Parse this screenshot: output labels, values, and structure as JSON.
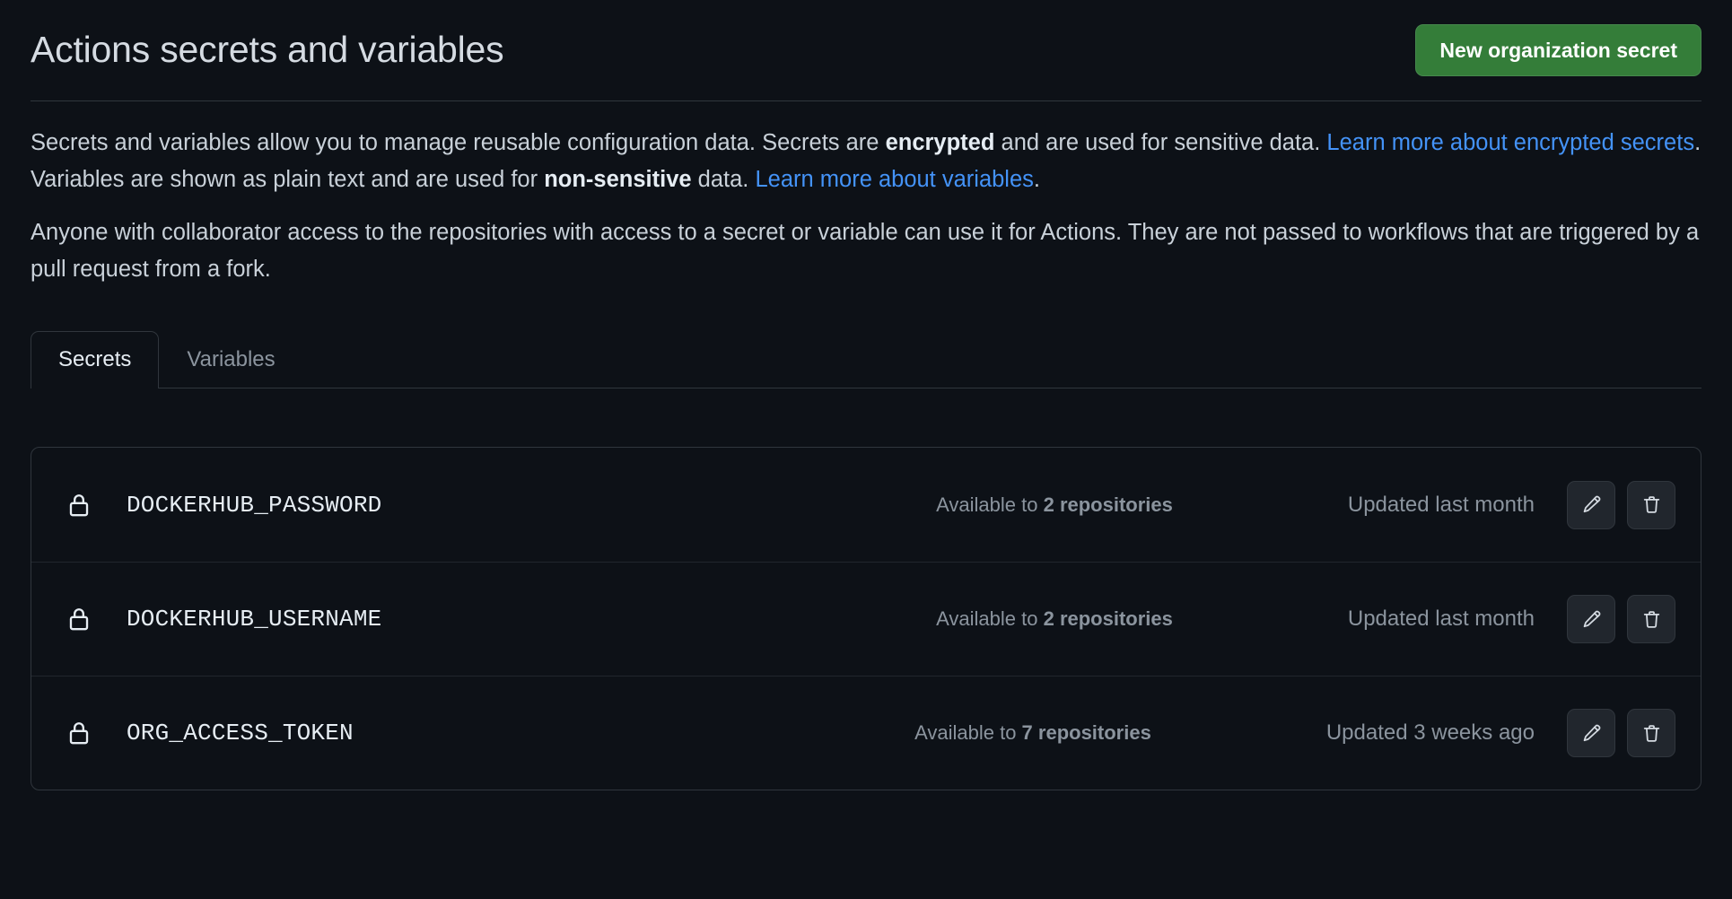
{
  "header": {
    "title": "Actions secrets and variables",
    "new_secret_button": "New organization secret",
    "button_color": "#347d39"
  },
  "description": {
    "p1": {
      "seg1": "Secrets and variables allow you to manage reusable configuration data. Secrets are ",
      "bold1": "encrypted",
      "seg2": " and are used for sensitive data. ",
      "link1": "Learn more about encrypted secrets",
      "seg3": ". Variables are shown as plain text and are used for ",
      "bold2": "non-sensitive",
      "seg4": " data. ",
      "link2": "Learn more about variables",
      "seg5": "."
    },
    "p2": "Anyone with collaborator access to the repositories with access to a secret or variable can use it for Actions. They are not passed to workflows that are triggered by a pull request from a fork."
  },
  "tabs": [
    {
      "label": "Secrets",
      "active": true
    },
    {
      "label": "Variables",
      "active": false
    }
  ],
  "secrets": [
    {
      "icon": "lock-icon",
      "name": "DOCKERHUB_PASSWORD",
      "availability_prefix": "Available to ",
      "availability_count": "2 repositories",
      "updated": "Updated last month",
      "edit_label": "pencil-icon",
      "delete_label": "trash-icon"
    },
    {
      "icon": "lock-icon",
      "name": "DOCKERHUB_USERNAME",
      "availability_prefix": "Available to ",
      "availability_count": "2 repositories",
      "updated": "Updated last month",
      "edit_label": "pencil-icon",
      "delete_label": "trash-icon"
    },
    {
      "icon": "lock-icon",
      "name": "ORG_ACCESS_TOKEN",
      "availability_prefix": "Available to ",
      "availability_count": "7 repositories",
      "updated": "Updated 3 weeks ago",
      "edit_label": "pencil-icon",
      "delete_label": "trash-icon"
    }
  ],
  "colors": {
    "background": "#0d1117",
    "border": "#30363d",
    "link": "#4493f8",
    "muted_text": "#8b949e",
    "primary_text": "#e6edf3"
  }
}
